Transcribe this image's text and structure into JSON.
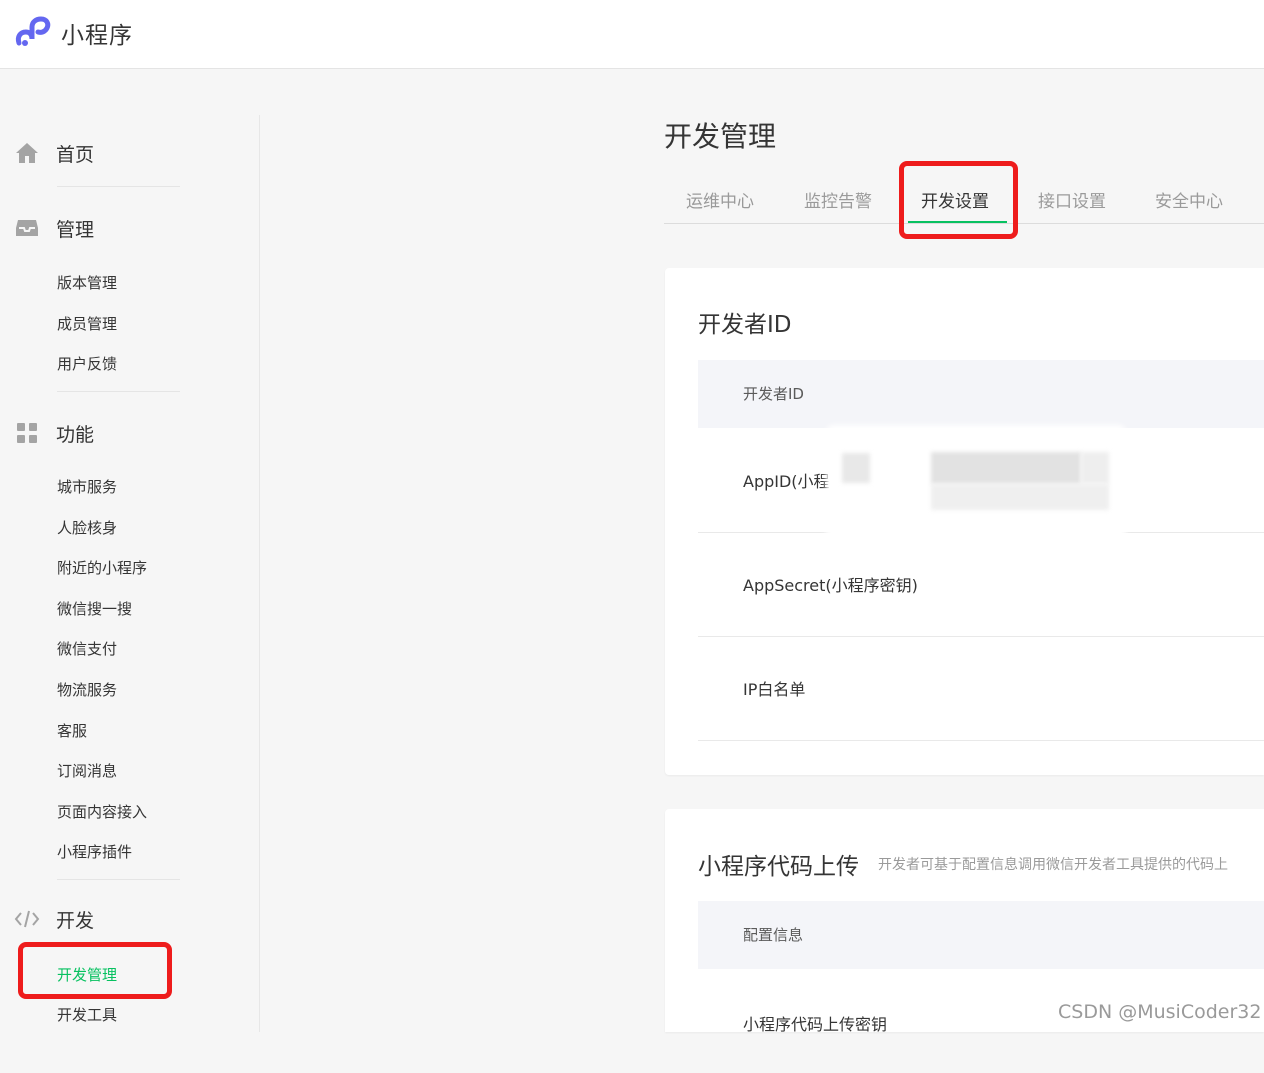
{
  "app": {
    "title": "小程序"
  },
  "sidebar": {
    "home": "首页",
    "manage": {
      "label": "管理",
      "items": [
        "版本管理",
        "成员管理",
        "用户反馈"
      ]
    },
    "features": {
      "label": "功能",
      "items": [
        "城市服务",
        "人脸核身",
        "附近的小程序",
        "微信搜一搜",
        "微信支付",
        "物流服务",
        "客服",
        "订阅消息",
        "页面内容接入",
        "小程序插件"
      ]
    },
    "dev": {
      "label": "开发",
      "items": [
        "开发管理",
        "开发工具"
      ],
      "active_item": "开发管理"
    }
  },
  "main": {
    "title": "开发管理",
    "tabs": [
      "运维中心",
      "监控告警",
      "开发设置",
      "接口设置",
      "安全中心"
    ],
    "active_tab": "开发设置",
    "developer_id_card": {
      "title": "开发者ID",
      "header": "开发者ID",
      "rows": [
        "AppID(小程",
        "AppSecret(小程序密钥)",
        "IP白名单"
      ]
    },
    "upload_card": {
      "title": "小程序代码上传",
      "description": "开发者可基于配置信息调用微信开发者工具提供的代码上",
      "header": "配置信息",
      "rows": [
        "小程序代码上传密钥"
      ]
    }
  },
  "colors": {
    "accent": "#07c160",
    "highlight": "#ee1c1c",
    "logo": "#6467f0"
  },
  "watermark": "CSDN @MusiCoder32"
}
